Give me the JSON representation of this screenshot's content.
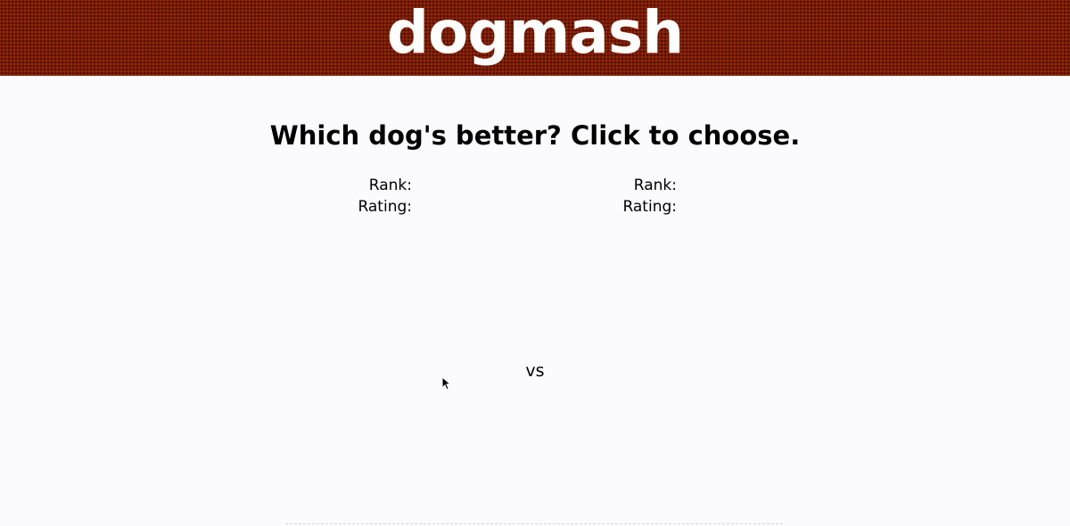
{
  "header": {
    "logo": "dogmash",
    "background_color": "#7a1a00"
  },
  "main": {
    "heading": "Which dog's better? Click to choose.",
    "vs_label": "vs"
  },
  "left_dog": {
    "rank_label": "Rank:",
    "rating_label": "Rating:"
  },
  "right_dog": {
    "rank_label": "Rank:",
    "rating_label": "Rating:"
  },
  "icons": {
    "cursor": "mouse-pointer-icon"
  }
}
